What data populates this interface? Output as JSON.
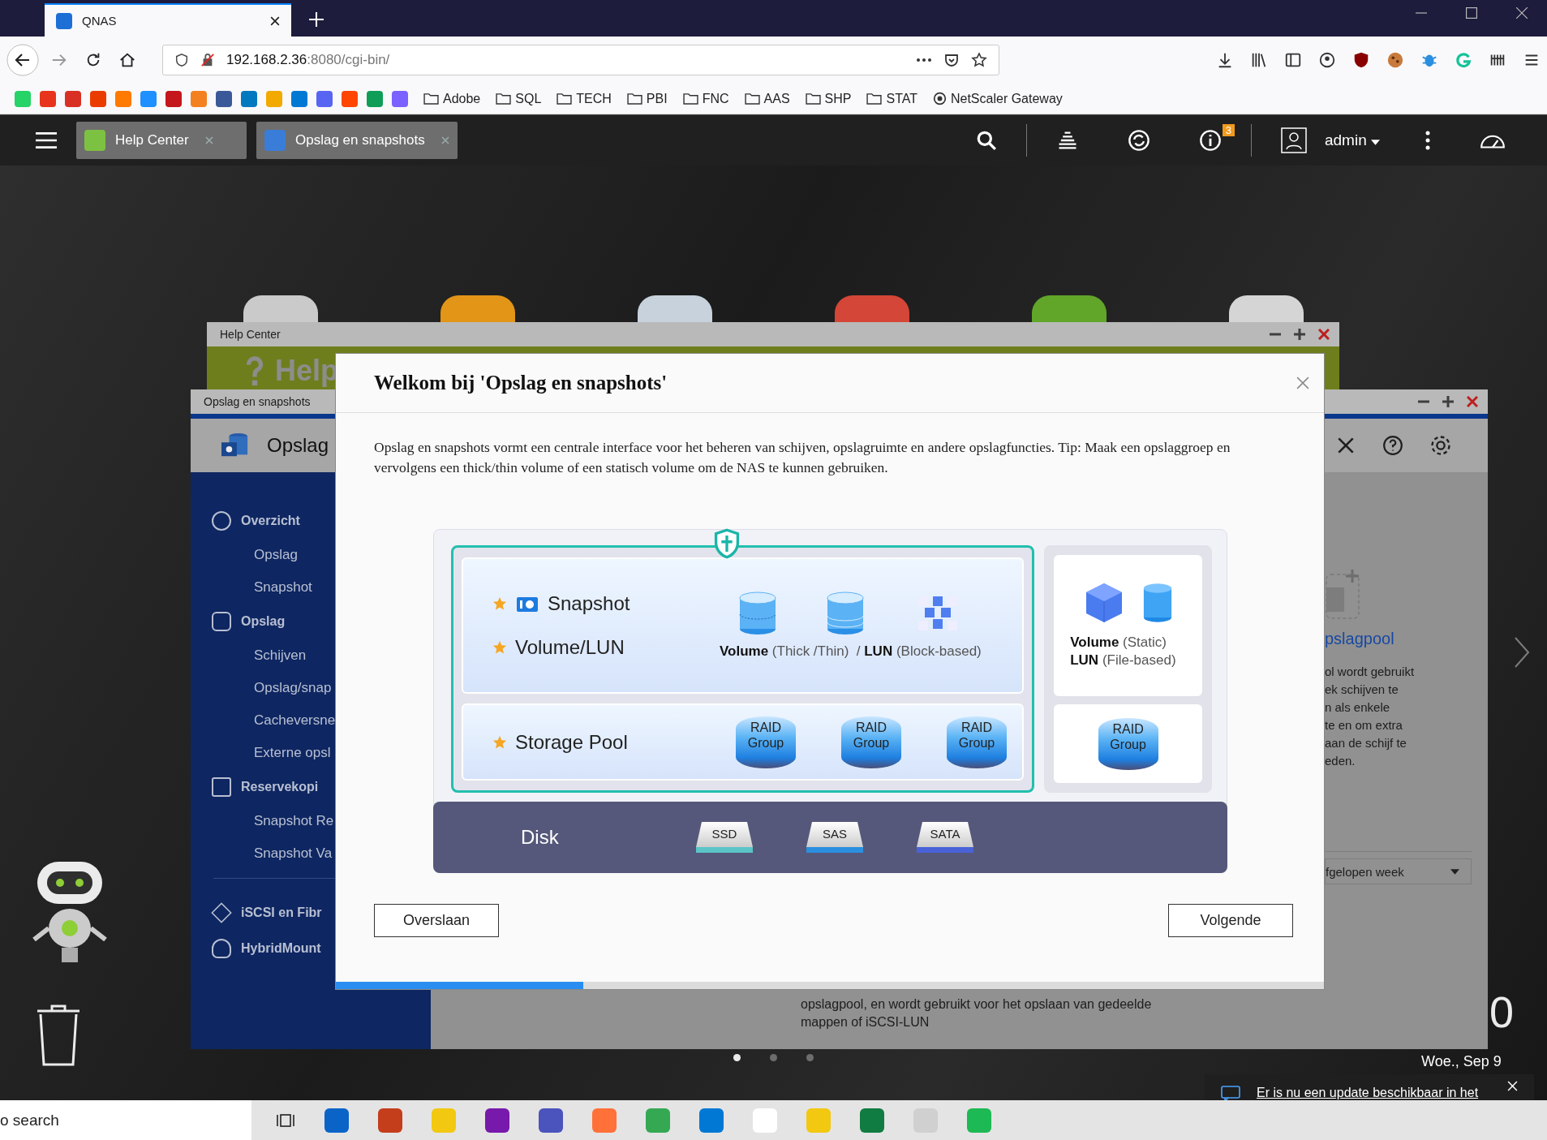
{
  "browser": {
    "tab_title": "QNAS",
    "url_host": "192.168.2.36",
    "url_rest": ":8080/cgi-bin/",
    "bookmark_folders": [
      "Adobe",
      "SQL",
      "TECH",
      "PBI",
      "FNC",
      "AAS",
      "SHP",
      "STAT"
    ],
    "bookmark_link": "NetScaler Gateway"
  },
  "qts_bar": {
    "tabs": [
      {
        "label": "Help Center",
        "kind": "help"
      },
      {
        "label": "Opslag en snapshots",
        "kind": "storage"
      }
    ],
    "notification_count": "3",
    "user": "admin"
  },
  "help_window": {
    "title": "Help Center",
    "heading": "Help"
  },
  "storage_window": {
    "title": "Opslag en snapshots",
    "heading": "Opslag",
    "nav": [
      {
        "label": "Overzicht",
        "kind": "gauge",
        "children": [
          "Opslag",
          "Snapshot"
        ]
      },
      {
        "label": "Opslag",
        "kind": "database",
        "children": [
          "Schijven",
          "Opslag/snap",
          "Cacheversne",
          "Externe opsl"
        ]
      },
      {
        "label": "Reservekopi",
        "kind": "camera",
        "children": [
          "Snapshot Re",
          "Snapshot Va"
        ]
      }
    ],
    "nav_extra": [
      {
        "label": "iSCSI en Fibr",
        "kind": "iscsi"
      },
      {
        "label": "HybridMount",
        "kind": "cloud"
      }
    ],
    "panel_title": "pslagpool",
    "panel_lines": [
      "ol wordt gebruikt",
      "ek schijven te",
      "n als enkele",
      "te en om extra",
      "aan de schijf te",
      "eden."
    ],
    "period": "fgelopen week",
    "footer_lines": [
      "opslagpool, en wordt gebruikt voor het opslaan van gedeelde",
      "mappen of iSCSI-LUN"
    ]
  },
  "pager": [
    {
      "selected": true
    },
    {
      "selected": false
    },
    {
      "selected": false
    }
  ],
  "clock": {
    "digit": "0",
    "date": "Woe., Sep 9"
  },
  "dialog": {
    "title": "Welkom bij 'Opslag en snapshots'",
    "intro": "Opslag en snapshots vormt een centrale interface voor het beheren van schijven, opslagruimte en andere opslagfuncties. Tip: Maak een opslaggroep en vervolgens een thick/thin volume of een statisch volume om de NAS te kunnen gebruiken.",
    "snapshot_label": "Snapshot",
    "volume_label": "Volume/LUN",
    "volume_caption": "**Volume** (Thick /Thin)  / **LUN** (Block-based)",
    "pool_label": "Storage Pool",
    "raid_groups": [
      "RAID Group",
      "RAID Group",
      "RAID Group"
    ],
    "static_caption": [
      "**Volume** (Static)",
      "**LUN** (File-based)"
    ],
    "static_raid": "RAID Group",
    "disk_label": "Disk",
    "disks": [
      {
        "label": "SSD",
        "color": "#5bc4c6"
      },
      {
        "label": "SAS",
        "color": "#2b8fe0"
      },
      {
        "label": "SATA",
        "color": "#4a62d8"
      }
    ],
    "skip": "Overslaan",
    "next": "Volgende",
    "progress": {
      "level": 0.25
    }
  },
  "notification": {
    "text": "Er is nu een update beschikbaar in het"
  },
  "taskbar": {
    "search": "o search"
  }
}
